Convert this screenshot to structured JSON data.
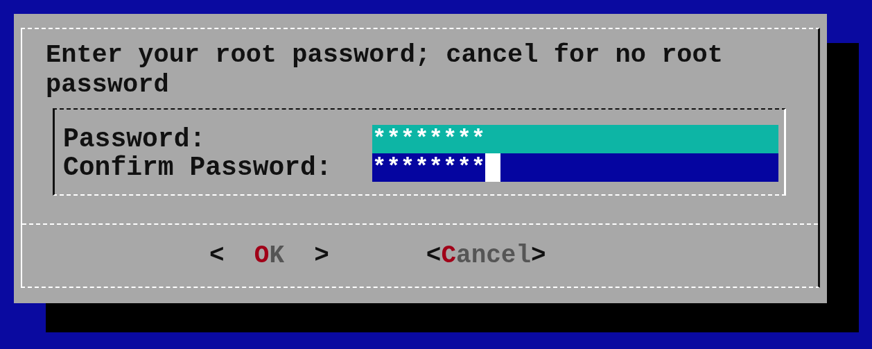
{
  "dialog": {
    "message": "Enter your root password; cancel for no root password",
    "fields": [
      {
        "label": "Password:",
        "value": "********",
        "focused": false
      },
      {
        "label": "Confirm Password:",
        "value": "********",
        "focused": true
      }
    ],
    "buttons": [
      {
        "left": "<",
        "label": "OK",
        "right": ">",
        "wide": true
      },
      {
        "left": "<",
        "label": "Cancel",
        "right": ">",
        "wide": false
      }
    ]
  }
}
